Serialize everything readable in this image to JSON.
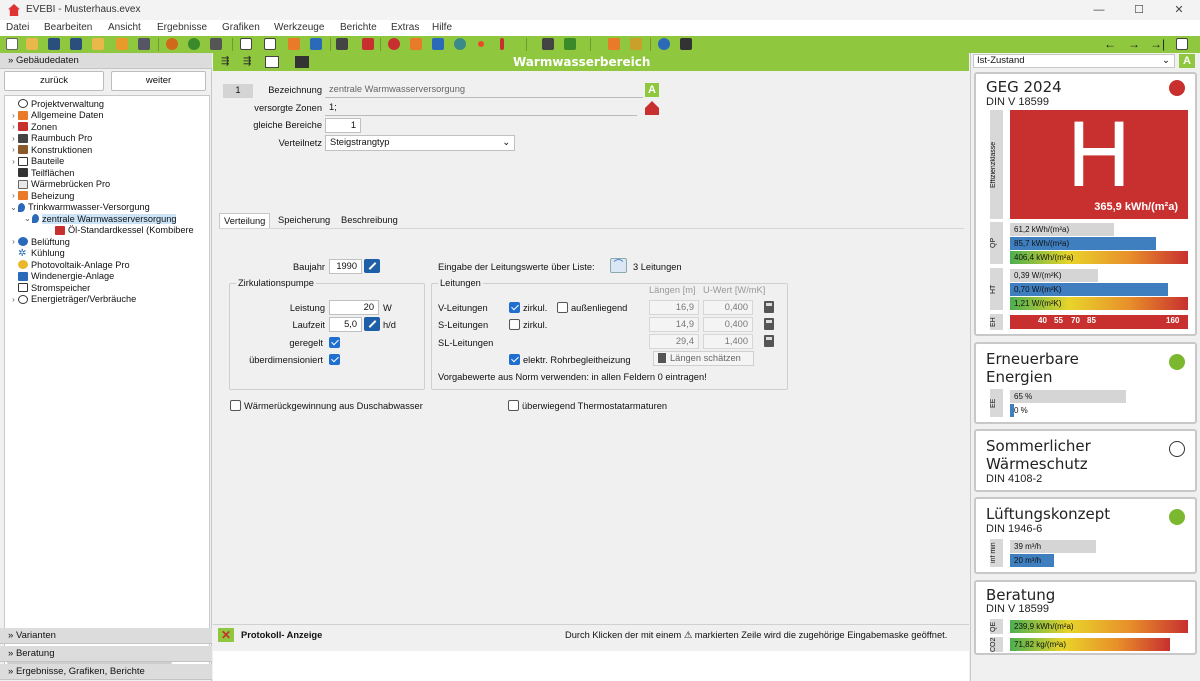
{
  "app": {
    "title": "EVEBI - Musterhaus.evex"
  },
  "menu": [
    "Datei",
    "Bearbeiten",
    "Ansicht",
    "Ergebnisse",
    "Grafiken",
    "Werkzeuge",
    "Berichte",
    "Extras",
    "Hilfe"
  ],
  "left": {
    "header": "Gebäudedaten",
    "back": "zurück",
    "next": "weiter",
    "tree": [
      "Projektverwaltung",
      "Allgemeine Daten",
      "Zonen",
      "Raumbuch Pro",
      "Konstruktionen",
      "Bauteile",
      "Teilflächen",
      "Wärmebrücken Pro",
      "Beheizung",
      "Trinkwarmwasser-Versorgung",
      "zentrale Warmwasserversorgung",
      "Öl-Standardkessel (Kombibere",
      "Belüftung",
      "Kühlung",
      "Photovoltaik-Anlage Pro",
      "Windenergie-Anlage",
      "Stromspeicher",
      "Energieträger/Verbräuche"
    ],
    "sections": [
      "Varianten",
      "Beratung",
      "Ergebnisse, Grafiken, Berichte"
    ]
  },
  "main": {
    "title": "Warmwasserbereich",
    "index": "1",
    "bezeichnung_label": "Bezeichnung",
    "bezeichnung_value": "zentrale Warmwasserversorgung",
    "zonen_label": "versorgte Zonen",
    "zonen_value": "1;",
    "bereiche_label": "gleiche Bereiche",
    "bereiche_value": "1",
    "verteilnetz_label": "Verteilnetz",
    "verteilnetz_value": "Steigstrangtyp",
    "tabs": [
      "Verteilung",
      "Speicherung",
      "Beschreibung"
    ],
    "baujahr_label": "Baujahr",
    "baujahr_value": "1990",
    "pumpe_group": "Zirkulationspumpe",
    "leistung_label": "Leistung",
    "leistung_value": "20",
    "leistung_unit": "W",
    "laufzeit_label": "Laufzeit",
    "laufzeit_value": "5,0",
    "laufzeit_unit": "h/d",
    "geregelt_label": "geregelt",
    "ueber_label": "überdimensioniert",
    "liste_label": "Eingabe der Leitungswerte über Liste:",
    "liste_value": "3 Leitungen",
    "leitungen_group": "Leitungen",
    "col_laengen": "Längen [m]",
    "col_uwert": "U-Wert [W/mK]",
    "v_label": "V-Leitungen",
    "zirkul": "zirkul.",
    "aussen": "außenliegend",
    "v_len": "16,9",
    "v_u": "0,400",
    "s_label": "S-Leitungen",
    "s_len": "14,9",
    "s_u": "0,400",
    "sl_label": "SL-Leitungen",
    "sl_len": "29,4",
    "sl_u": "1,400",
    "rohr_label": "elektr. Rohrbegleitheizung",
    "schaetzen_label": "Längen schätzen",
    "norm_hint": "Vorgabewerte aus Norm verwenden: in allen Feldern 0 eintragen!",
    "wrg_label": "Wärmerückgewinnung aus Duschabwasser",
    "thermo_label": "überwiegend Thermostatarmaturen",
    "protokoll_label": "Protokoll- Anzeige",
    "protokoll_hint": "Durch Klicken der mit einem ⚠ markierten Zeile wird die zugehörige Eingabemaske geöffnet."
  },
  "right": {
    "state": "Ist-Zustand",
    "geg": {
      "title": "GEG 2024",
      "sub": "DIN V 18599",
      "class": "H",
      "value": "365,9 kWh/(m²a)",
      "class_label": "Effizienzklasse",
      "qp_label": "QP",
      "qp": [
        "61,2 kWh/(m²a)",
        "85,7 kWh/(m²a)",
        "406,4 kWh/(m²a)"
      ],
      "ht_label": "HT",
      "ht": [
        "0,39 W/(m²K)",
        "0,70 W/(m²K)",
        "1,21 W/(m²K)"
      ],
      "eh_label": "EH",
      "eh": [
        "40",
        "55",
        "70",
        "85",
        "160"
      ],
      "status_color": "#c8302f"
    },
    "ee": {
      "title1": "Erneuerbare",
      "title2": "Energien",
      "label": "EE",
      "vals": [
        "65 %",
        "0 %"
      ],
      "status_color": "#7cb82f"
    },
    "sw": {
      "title1": "Sommerlicher",
      "title2": "Wärmeschutz",
      "sub": "DIN 4108-2"
    },
    "lk": {
      "title": "Lüftungskonzept",
      "sub": "DIN 1946-6",
      "label": "inf min",
      "vals": [
        "39 m³/h",
        "20 m³/h"
      ],
      "status_color": "#7cb82f"
    },
    "ber": {
      "title": "Beratung",
      "sub": "DIN V 18599",
      "qe_label": "QE",
      "qe": "239,9 kWh/(m²a)",
      "co2_label": "CO2",
      "co2": "71,82 kg/(m²a)"
    }
  },
  "colors": {
    "accent": "#8fc73e",
    "bar_blue": "#3f7fbf",
    "bar_gray": "#d5d5d5",
    "danger": "#c8302f"
  }
}
